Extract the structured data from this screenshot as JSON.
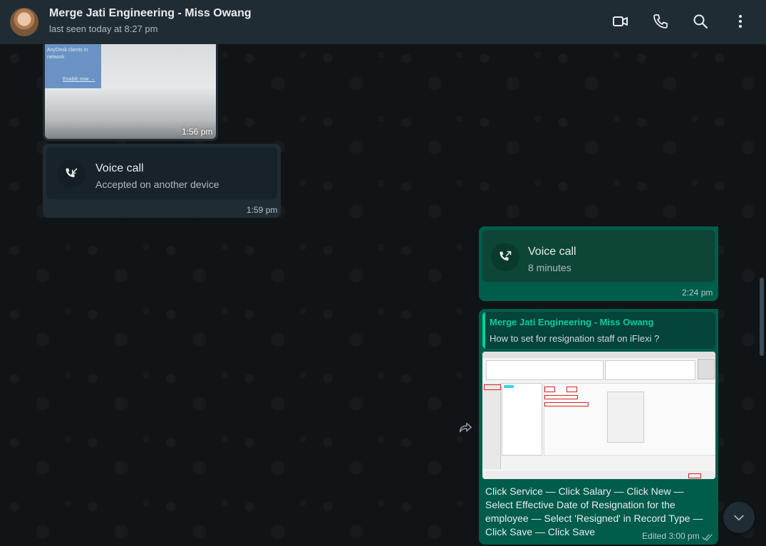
{
  "header": {
    "contact_name": "Merge Jati Engineering - Miss Owang",
    "status": "last seen today at 8:27 pm",
    "icons": [
      "video-call-icon",
      "voice-call-icon",
      "search-icon",
      "menu-icon"
    ]
  },
  "messages": {
    "image_in": {
      "partial_text": "AnyDesk clients in network",
      "link": "Enable now →",
      "time": "1:56 pm"
    },
    "call_in": {
      "title": "Voice call",
      "subtitle": "Accepted on another device",
      "time": "1:59 pm"
    },
    "call_out": {
      "title": "Voice call",
      "subtitle": "8 minutes",
      "time": "2:24 pm"
    },
    "reply_out": {
      "quoted_name": "Merge Jati Engineering - Miss Owang",
      "quoted_text": "How to set for resignation staff on iFlexi ?",
      "text": "Click Service — Click Salary — Click New — Select Effective Date of Resignation for the employee — Select 'Resigned' in Record Type — Click Save — Click Save",
      "meta": "Edited 3:00 pm"
    }
  },
  "colors": {
    "header_bg": "#202c33",
    "incoming_bubble": "#202c33",
    "outgoing_bubble": "#005c4b",
    "accent": "#06cf9c"
  }
}
